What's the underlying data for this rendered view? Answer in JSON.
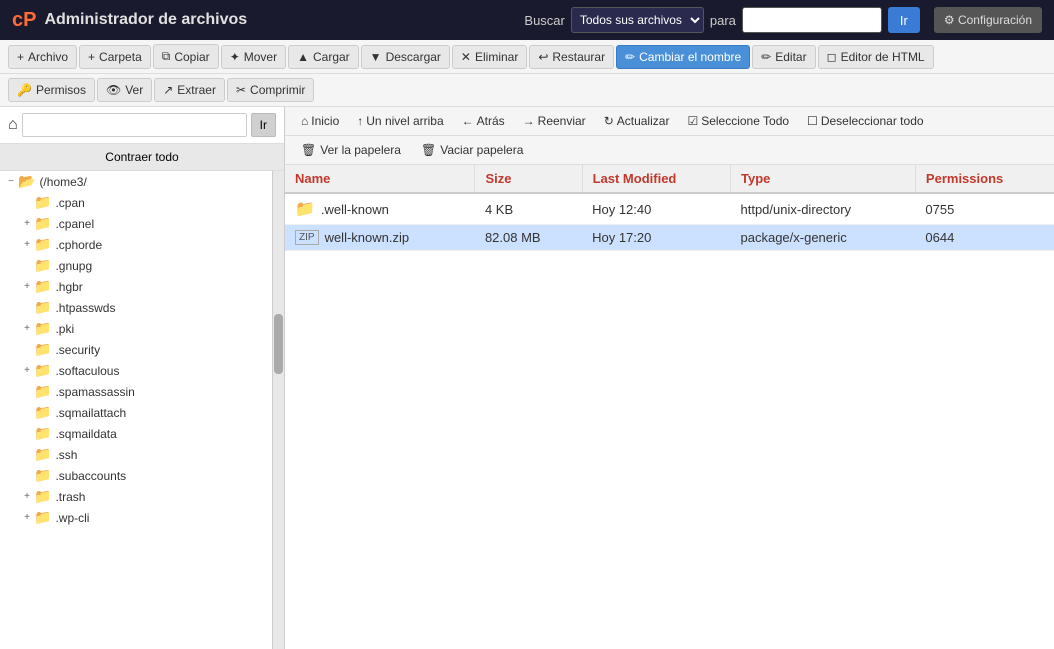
{
  "header": {
    "logo_icon": "cP",
    "title": "Administrador de archivos",
    "search_label": "Buscar",
    "search_options": [
      "Todos sus archivos"
    ],
    "search_para": "para",
    "go_button": "Ir",
    "config_button": "⚙ Configuración"
  },
  "toolbar1": {
    "buttons": [
      {
        "id": "archivo",
        "icon": "+",
        "label": "Archivo"
      },
      {
        "id": "carpeta",
        "icon": "+",
        "label": "Carpeta"
      },
      {
        "id": "copiar",
        "icon": "⧉",
        "label": "Copiar"
      },
      {
        "id": "mover",
        "icon": "✦",
        "label": "Mover"
      },
      {
        "id": "cargar",
        "icon": "▲",
        "label": "Cargar"
      },
      {
        "id": "descargar",
        "icon": "▼",
        "label": "Descargar"
      },
      {
        "id": "eliminar",
        "icon": "✕",
        "label": "Eliminar"
      },
      {
        "id": "restaurar",
        "icon": "↩",
        "label": "Restaurar"
      },
      {
        "id": "cambiar-nombre",
        "icon": "✏",
        "label": "Cambiar el nombre"
      },
      {
        "id": "editar",
        "icon": "✏",
        "label": "Editar"
      },
      {
        "id": "editor-html",
        "icon": "◻",
        "label": "Editor de HTML"
      }
    ]
  },
  "toolbar2": {
    "buttons": [
      {
        "id": "permisos",
        "icon": "🔑",
        "label": "Permisos"
      },
      {
        "id": "ver",
        "icon": "👁",
        "label": "Ver"
      },
      {
        "id": "extraer",
        "icon": "↗",
        "label": "Extraer"
      },
      {
        "id": "comprimir",
        "icon": "✂",
        "label": "Comprimir"
      }
    ]
  },
  "left_panel": {
    "path_placeholder": "",
    "path_go": "Ir",
    "collapse_btn": "Contraer todo",
    "home_icon": "⌂",
    "tree": [
      {
        "level": 0,
        "toggle": "−",
        "icon": "folder-open",
        "label": "(/home3/",
        "selected": false
      },
      {
        "level": 1,
        "toggle": "",
        "icon": "folder",
        "label": ".cpan",
        "selected": false
      },
      {
        "level": 1,
        "toggle": "+",
        "icon": "folder",
        "label": ".cpanel",
        "selected": false
      },
      {
        "level": 1,
        "toggle": "+",
        "icon": "folder",
        "label": ".cphorde",
        "selected": false
      },
      {
        "level": 1,
        "toggle": "",
        "icon": "folder",
        "label": ".gnupg",
        "selected": false
      },
      {
        "level": 1,
        "toggle": "+",
        "icon": "folder",
        "label": ".hgbr",
        "selected": false
      },
      {
        "level": 1,
        "toggle": "",
        "icon": "folder",
        "label": ".htpasswds",
        "selected": false
      },
      {
        "level": 1,
        "toggle": "+",
        "icon": "folder",
        "label": ".pki",
        "selected": false
      },
      {
        "level": 1,
        "toggle": "",
        "icon": "folder",
        "label": ".security",
        "selected": false
      },
      {
        "level": 1,
        "toggle": "+",
        "icon": "folder",
        "label": ".softaculous",
        "selected": false
      },
      {
        "level": 1,
        "toggle": "",
        "icon": "folder",
        "label": ".spamassassin",
        "selected": false
      },
      {
        "level": 1,
        "toggle": "",
        "icon": "folder",
        "label": ".sqmailattach",
        "selected": false
      },
      {
        "level": 1,
        "toggle": "",
        "icon": "folder",
        "label": ".sqmaildata",
        "selected": false
      },
      {
        "level": 1,
        "toggle": "",
        "icon": "folder",
        "label": ".ssh",
        "selected": false
      },
      {
        "level": 1,
        "toggle": "",
        "icon": "folder",
        "label": ".subaccounts",
        "selected": false
      },
      {
        "level": 1,
        "toggle": "+",
        "icon": "folder",
        "label": ".trash",
        "selected": false
      },
      {
        "level": 1,
        "toggle": "+",
        "icon": "folder",
        "label": ".wp-cli",
        "selected": false
      }
    ]
  },
  "nav_bar": {
    "buttons": [
      {
        "id": "inicio",
        "icon": "⌂",
        "label": "Inicio"
      },
      {
        "id": "un-nivel-arriba",
        "icon": "↑",
        "label": "Un nivel arriba"
      },
      {
        "id": "atras",
        "icon": "←",
        "label": "Atrás"
      },
      {
        "id": "reenviar",
        "icon": "→",
        "label": "Reenviar"
      },
      {
        "id": "actualizar",
        "icon": "↻",
        "label": "Actualizar"
      },
      {
        "id": "seleccione-todo",
        "icon": "☑",
        "label": "Seleccione Todo"
      },
      {
        "id": "deseleccionar-todo",
        "icon": "☐",
        "label": "Deseleccionar todo"
      }
    ]
  },
  "actions_bar": {
    "buttons": [
      {
        "id": "ver-papelera",
        "icon": "🗑",
        "label": "Ver la papelera"
      },
      {
        "id": "vaciar-papelera",
        "icon": "🗑",
        "label": "Vaciar papelera"
      }
    ]
  },
  "file_table": {
    "headers": [
      "Name",
      "Size",
      "Last Modified",
      "Type",
      "Permissions"
    ],
    "rows": [
      {
        "id": "well-known-dir",
        "icon": "folder",
        "name": ".well-known",
        "size": "4 KB",
        "last_modified": "Hoy 12:40",
        "type": "httpd/unix-directory",
        "permissions": "0755",
        "selected": false
      },
      {
        "id": "well-known-zip",
        "icon": "zip",
        "name": "well-known.zip",
        "size": "82.08 MB",
        "last_modified": "Hoy 17:20",
        "type": "package/x-generic",
        "permissions": "0644",
        "selected": true
      }
    ]
  },
  "colors": {
    "header_bg": "#1a1a2e",
    "accent": "#3a7bd5",
    "folder": "#e8a000",
    "selected_row": "#cce0ff",
    "column_header": "#c0392b"
  }
}
